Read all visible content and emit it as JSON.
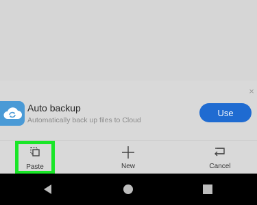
{
  "banner": {
    "title": "Auto backup",
    "subtitle": "Automatically back up files to Cloud",
    "use_label": "Use",
    "close_glyph": "×",
    "icon": "cloud-sync-icon"
  },
  "toolbar": {
    "items": [
      {
        "label": "Paste",
        "icon": "paste-icon"
      },
      {
        "label": "New",
        "icon": "plus-icon"
      },
      {
        "label": "Cancel",
        "icon": "return-icon"
      }
    ]
  },
  "navbar": {
    "icons": [
      "back-icon",
      "home-icon",
      "recents-icon"
    ]
  },
  "colors": {
    "accent": "#1f6bd1",
    "highlight": "#19e627",
    "cloud_icon_bg": "#4a9ad6"
  }
}
